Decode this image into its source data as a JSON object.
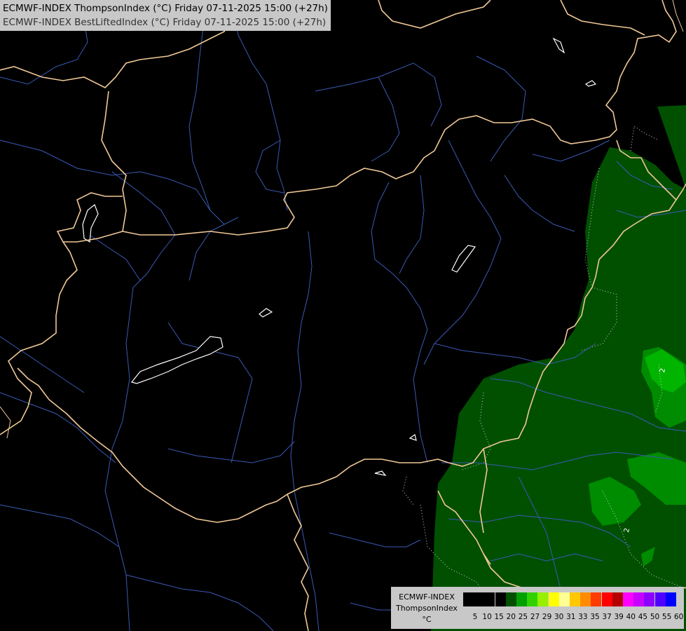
{
  "header": {
    "line1": "ECMWF-INDEX ThompsonIndex (°C) Friday 07-11-2025 15:00 (+27h)",
    "line2": "ECMWF-INDEX BestLiftedIndex (°C) Friday 07-11-2025 15:00 (+27h)"
  },
  "map": {
    "contour_labels": [
      "2",
      "2"
    ],
    "colors": {
      "background": "#000000",
      "borders": "#f0c896",
      "rivers": "#3a5ab4",
      "lakes": "#ffffff",
      "field_dark": "#005000",
      "field_mid": "#008c00",
      "field_light": "#00b400"
    }
  },
  "legend": {
    "title_lines": [
      "ECMWF-INDEX",
      "ThompsonIndex",
      "°C"
    ],
    "swatches": [
      "#000000",
      "#000000",
      "#000000",
      "#000000",
      "#005000",
      "#00a000",
      "#32d200",
      "#96f000",
      "#ffff00",
      "#ffff96",
      "#ffc800",
      "#ff8c00",
      "#ff3c00",
      "#ff0000",
      "#b40000",
      "#ff00ff",
      "#c800ff",
      "#8c00ff",
      "#5000ff",
      "#0000ff"
    ],
    "ticks": [
      "5",
      "10",
      "15",
      "20",
      "25",
      "27",
      "29",
      "30",
      "31",
      "33",
      "35",
      "37",
      "39",
      "40",
      "45",
      "50",
      "55",
      "60"
    ]
  }
}
